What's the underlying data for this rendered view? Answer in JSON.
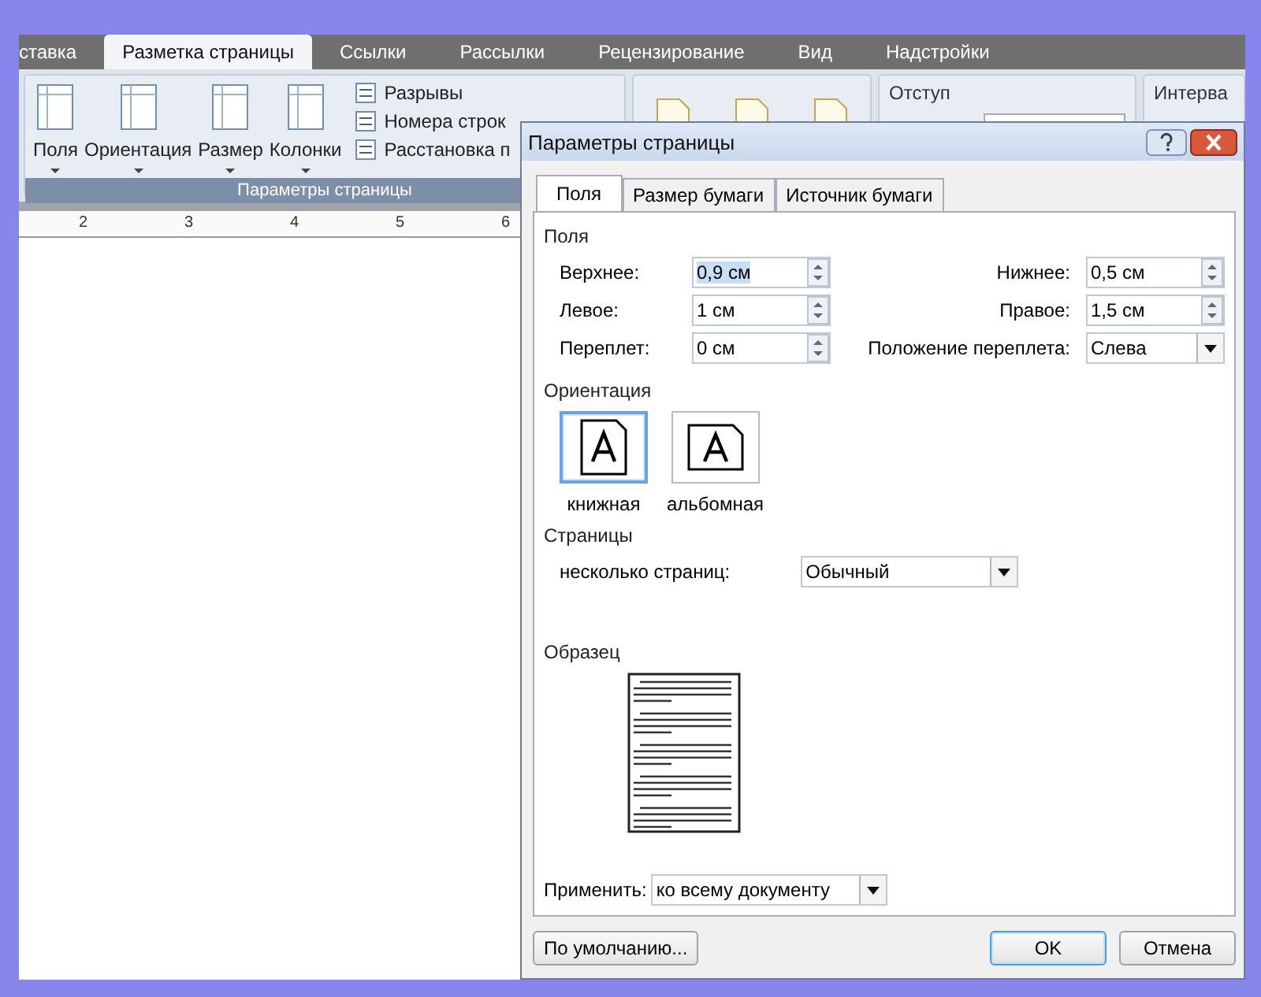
{
  "ribbon": {
    "tabs": [
      {
        "label": "ставка",
        "selected": false
      },
      {
        "label": "Разметка страницы",
        "selected": true
      },
      {
        "label": "Ссылки",
        "selected": false
      },
      {
        "label": "Рассылки",
        "selected": false
      },
      {
        "label": "Рецензирование",
        "selected": false
      },
      {
        "label": "Вид",
        "selected": false
      },
      {
        "label": "Надстройки",
        "selected": false
      }
    ],
    "page_setup_group": {
      "label": "Параметры страницы",
      "large_buttons": [
        "Поля",
        "Ориентация",
        "Размер",
        "Колонки"
      ],
      "small_buttons": [
        "Разрывы",
        "Номера строк",
        "Расстановка п"
      ]
    },
    "indent_label": "Отступ",
    "spacing_label": "Интерва"
  },
  "ruler": {
    "numbers": [
      "2",
      "3",
      "4",
      "5",
      "6"
    ]
  },
  "dialog": {
    "title": "Параметры страницы",
    "tabs": [
      {
        "label": "Поля",
        "selected": true
      },
      {
        "label": "Размер бумаги",
        "selected": false
      },
      {
        "label": "Источник бумаги",
        "selected": false
      }
    ],
    "margins_heading": "Поля",
    "margins": [
      {
        "label": "Верхнее:",
        "value": "0,9 см",
        "focused": true
      },
      {
        "label": "Нижнее:",
        "value": "0,5 см",
        "focused": false
      },
      {
        "label": "Левое:",
        "value": "1 см",
        "focused": false
      },
      {
        "label": "Правое:",
        "value": "1,5 см",
        "focused": false
      },
      {
        "label": "Переплет:",
        "value": "0 см",
        "focused": false
      }
    ],
    "gutter_position": {
      "label": "Положение переплета:",
      "value": "Слева"
    },
    "orientation_heading": "Ориентация",
    "orientations": [
      {
        "label": "книжная",
        "selected": true,
        "kind": "portrait"
      },
      {
        "label": "альбомная",
        "selected": false,
        "kind": "landscape"
      }
    ],
    "pages_heading": "Страницы",
    "multiple_pages": {
      "label": "несколько страниц:",
      "value": "Обычный"
    },
    "preview_heading": "Образец",
    "apply": {
      "label": "Применить:",
      "value": "ко всему документу"
    },
    "buttons": [
      {
        "label": "По умолчанию...",
        "default": false
      },
      {
        "label": "OK",
        "default": true
      },
      {
        "label": "Отмена",
        "default": false
      }
    ]
  }
}
